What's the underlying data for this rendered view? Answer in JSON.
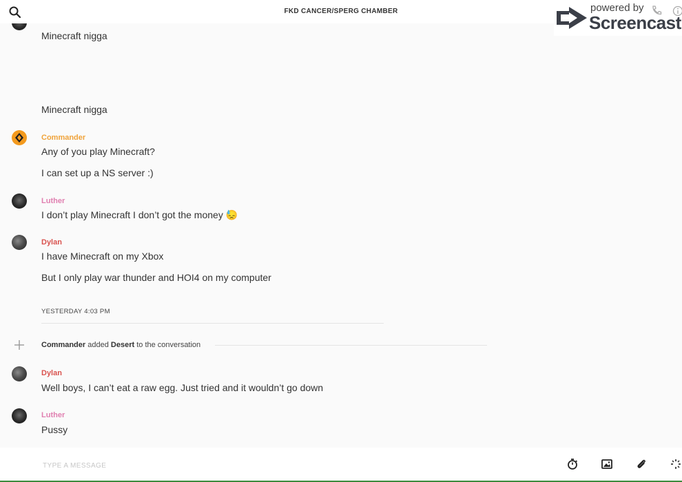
{
  "header": {
    "title": "FKD CANCER/SPERG CHAMBER"
  },
  "watermark": {
    "powered_by": "powered by",
    "brand": "Screencastify"
  },
  "messages": [
    {
      "author": "",
      "text": "Minecraft nigga"
    },
    {
      "author": "",
      "text": "Minecraft nigga"
    },
    {
      "author": "Commander",
      "author_color": "#f0a33a",
      "lines": [
        "Any of you play Minecraft?",
        "I can set up a NS server :)"
      ]
    },
    {
      "author": "Luther",
      "author_color": "#e07fb0",
      "lines": [
        "I don’t play Minecraft I don’t got the money 😓"
      ]
    },
    {
      "author": "Dylan",
      "author_color": "#d9534f",
      "lines": [
        "I have Minecraft on my Xbox",
        "But I only play war thunder and HOI4 on my computer"
      ]
    }
  ],
  "day_divider": "YESTERDAY 4:03 PM",
  "system_message": {
    "actor": "Commander",
    "verb": "added",
    "target": "Desert",
    "suffix": "to the conversation"
  },
  "later_messages": [
    {
      "author": "Dylan",
      "author_color": "#d9534f",
      "lines": [
        "Well boys, I can’t eat a raw egg. Just tried and it wouldn’t go down"
      ]
    },
    {
      "author": "Luther",
      "author_color": "#e07fb0",
      "lines": [
        "Pussy"
      ]
    }
  ],
  "composer": {
    "placeholder": "TYPE A MESSAGE",
    "value": ""
  },
  "icons": {
    "search": "search-icon",
    "phone": "phone-icon",
    "info": "info-icon",
    "timer": "timer-icon",
    "image": "image-icon",
    "attach": "paperclip-icon",
    "more": "sparkle-icon"
  }
}
